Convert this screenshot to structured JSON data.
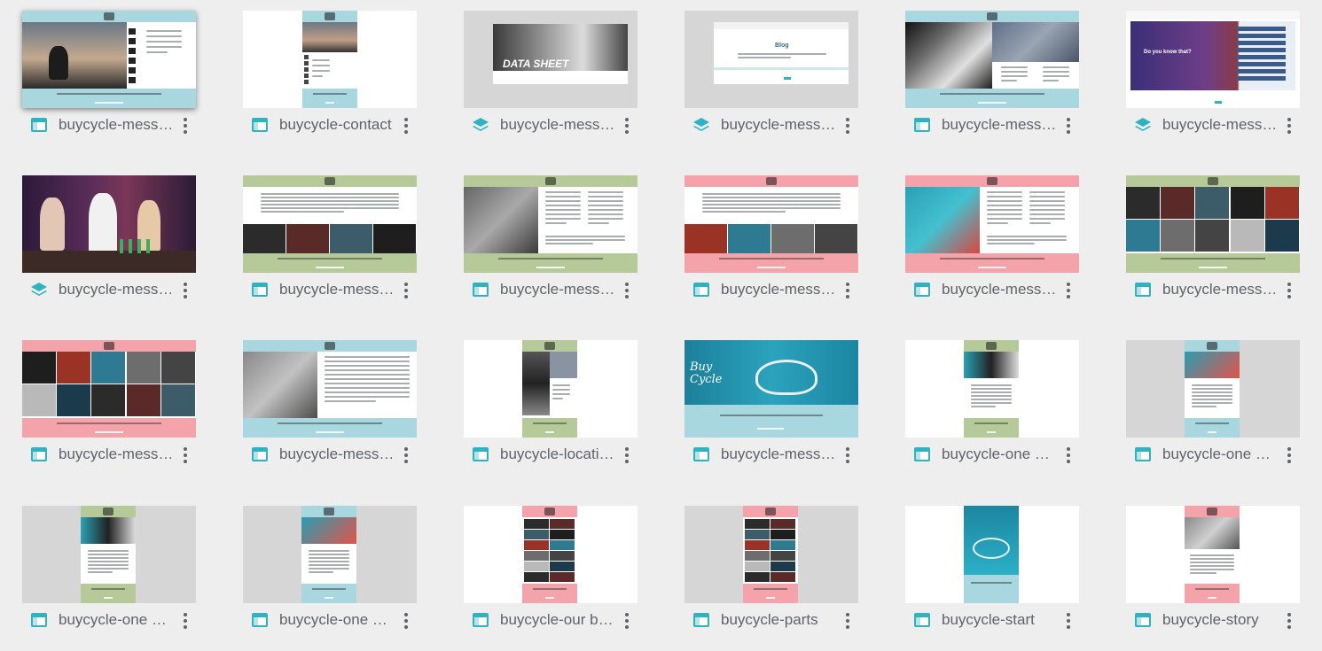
{
  "colors": {
    "teal": "#a9d7df",
    "green": "#b6c999",
    "pink": "#f5a3aa",
    "gray_bg": "#d6d6d6",
    "icon_teal": "#30b3c1"
  },
  "files": [
    {
      "name": "buycycle-messe…",
      "type": "page",
      "thumb": "contact-hero",
      "selected": true
    },
    {
      "name": "buycycle-contact",
      "type": "page",
      "thumb": "contact-mobile"
    },
    {
      "name": "buycycle-messe…",
      "type": "layers",
      "thumb": "data-sheet",
      "thumb_text": "DATA SHEET"
    },
    {
      "name": "buycycle-messe…",
      "type": "layers",
      "thumb": "blog",
      "thumb_text": "Blog"
    },
    {
      "name": "buycycle-messe…",
      "type": "page",
      "thumb": "location-bw"
    },
    {
      "name": "buycycle-messe…",
      "type": "layers",
      "thumb": "do-you-know",
      "thumb_text": "Do you know that?"
    },
    {
      "name": "buycycle-messe…",
      "type": "layers",
      "thumb": "video"
    },
    {
      "name": "buycycle-messe…",
      "type": "page",
      "thumb": "green-text-strip"
    },
    {
      "name": "buycycle-messe…",
      "type": "page",
      "thumb": "green-bike-detail"
    },
    {
      "name": "buycycle-messe…",
      "type": "page",
      "thumb": "pink-text-strip"
    },
    {
      "name": "buycycle-messe…",
      "type": "page",
      "thumb": "pink-wheel-detail"
    },
    {
      "name": "buycycle-messe…",
      "type": "page",
      "thumb": "green-grid"
    },
    {
      "name": "buycycle-messe…",
      "type": "page",
      "thumb": "pink-grid"
    },
    {
      "name": "buycycle-messe…",
      "type": "page",
      "thumb": "teal-story"
    },
    {
      "name": "buycycle-location",
      "type": "page",
      "thumb": "location-mobile"
    },
    {
      "name": "buycycle-messe…",
      "type": "page",
      "thumb": "buy-cycle-hero",
      "thumb_text": "Buy Cycle"
    },
    {
      "name": "buycycle-one of…",
      "type": "page",
      "thumb": "one-of-green"
    },
    {
      "name": "buycycle-one of…",
      "type": "page",
      "thumb": "one-of-teal"
    },
    {
      "name": "buycycle-one of…",
      "type": "page",
      "thumb": "one-of-green-2"
    },
    {
      "name": "buycycle-one of…",
      "type": "page",
      "thumb": "one-of-teal-2"
    },
    {
      "name": "buycycle-our br…",
      "type": "page",
      "thumb": "brands-mobile"
    },
    {
      "name": "buycycle-parts",
      "type": "page",
      "thumb": "parts-mobile"
    },
    {
      "name": "buycycle-start",
      "type": "page",
      "thumb": "start-mobile"
    },
    {
      "name": "buycycle-story",
      "type": "page",
      "thumb": "story-mobile"
    }
  ]
}
